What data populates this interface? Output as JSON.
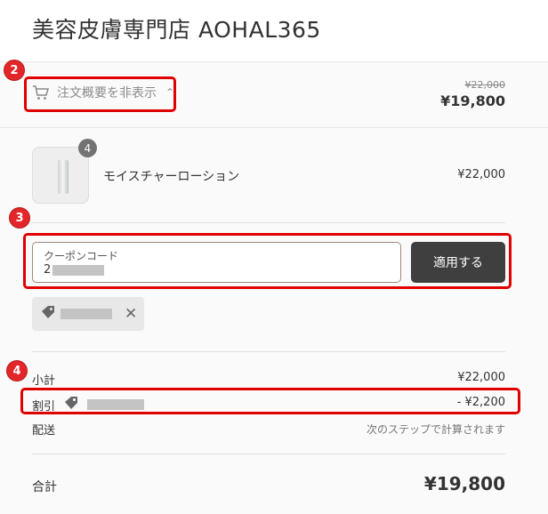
{
  "header": {
    "store_title": "美容皮膚専門店 AOHAL365"
  },
  "summary": {
    "toggle_label": "注文概要を非表示",
    "original_price": "¥22,000",
    "total": "¥19,800"
  },
  "annotations": {
    "step2": "2",
    "step3": "3",
    "step4": "4"
  },
  "product": {
    "quantity": "4",
    "name": "モイスチャーローション",
    "price": "¥22,000"
  },
  "coupon": {
    "label": "クーポンコード",
    "value_prefix": "2",
    "apply_label": "適用する",
    "tag_icon": "tag-icon",
    "remove_icon": "close-icon"
  },
  "totals": {
    "subtotal_label": "小計",
    "subtotal_value": "¥22,000",
    "discount_label": "割引",
    "discount_value": "- ¥2,200",
    "shipping_label": "配送",
    "shipping_value": "次のステップで計算されます",
    "total_label": "合計",
    "total_value": "¥19,800"
  },
  "colors": {
    "annotation_red": "#e3262a",
    "button_dark": "#3f3f3f"
  }
}
